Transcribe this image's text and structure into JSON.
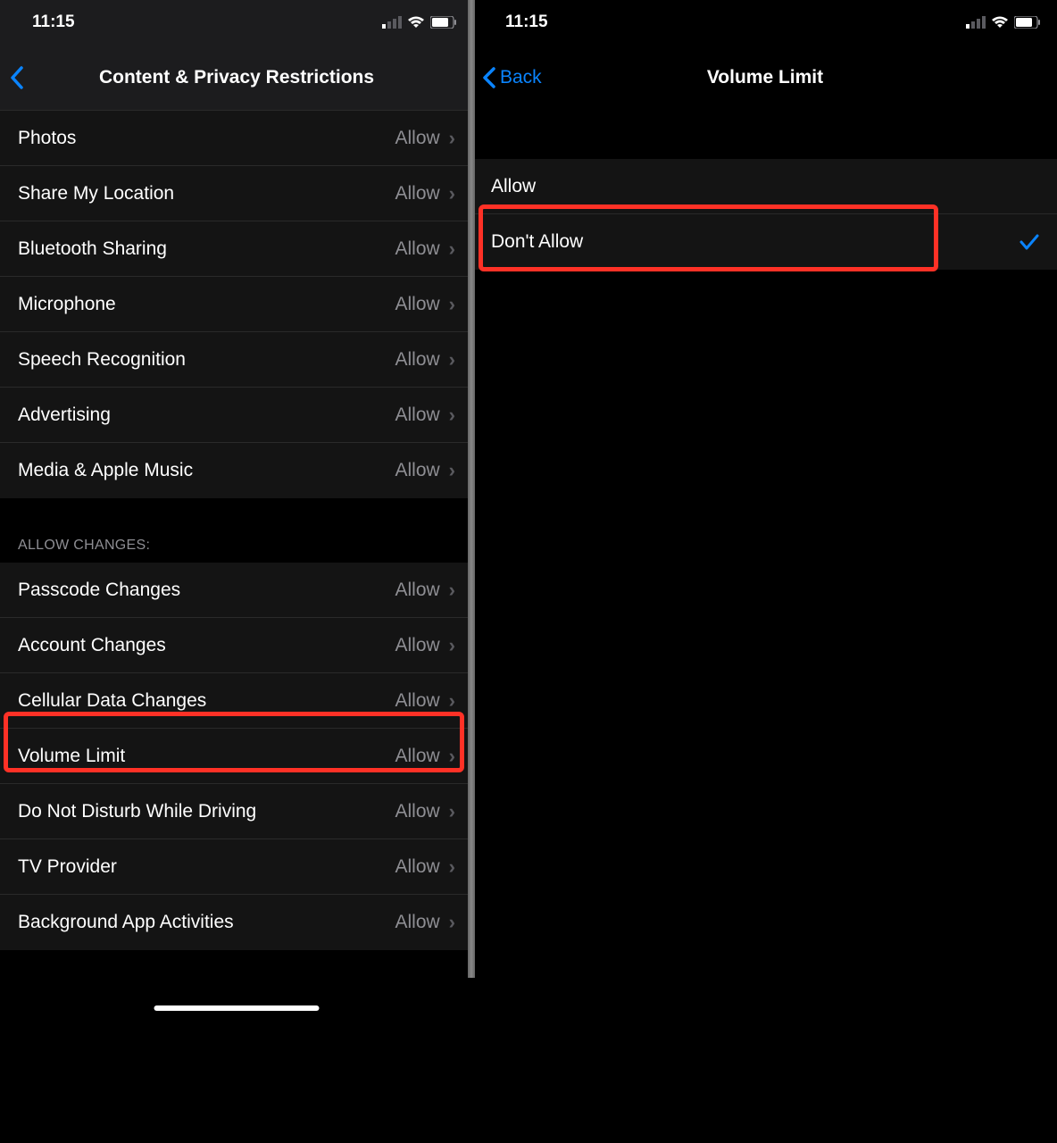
{
  "status": {
    "time": "11:15"
  },
  "left": {
    "title": "Content & Privacy Restrictions",
    "section1": [
      {
        "label": "Photos",
        "value": "Allow"
      },
      {
        "label": "Share My Location",
        "value": "Allow"
      },
      {
        "label": "Bluetooth Sharing",
        "value": "Allow"
      },
      {
        "label": "Microphone",
        "value": "Allow"
      },
      {
        "label": "Speech Recognition",
        "value": "Allow"
      },
      {
        "label": "Advertising",
        "value": "Allow"
      },
      {
        "label": "Media & Apple Music",
        "value": "Allow"
      }
    ],
    "section2_header": "Allow Changes:",
    "section2": [
      {
        "label": "Passcode Changes",
        "value": "Allow"
      },
      {
        "label": "Account Changes",
        "value": "Allow"
      },
      {
        "label": "Cellular Data Changes",
        "value": "Allow"
      },
      {
        "label": "Volume Limit",
        "value": "Allow"
      },
      {
        "label": "Do Not Disturb While Driving",
        "value": "Allow"
      },
      {
        "label": "TV Provider",
        "value": "Allow"
      },
      {
        "label": "Background App Activities",
        "value": "Allow"
      }
    ]
  },
  "right": {
    "back": "Back",
    "title": "Volume Limit",
    "options": [
      {
        "label": "Allow",
        "checked": false
      },
      {
        "label": "Don't Allow",
        "checked": true
      }
    ]
  }
}
